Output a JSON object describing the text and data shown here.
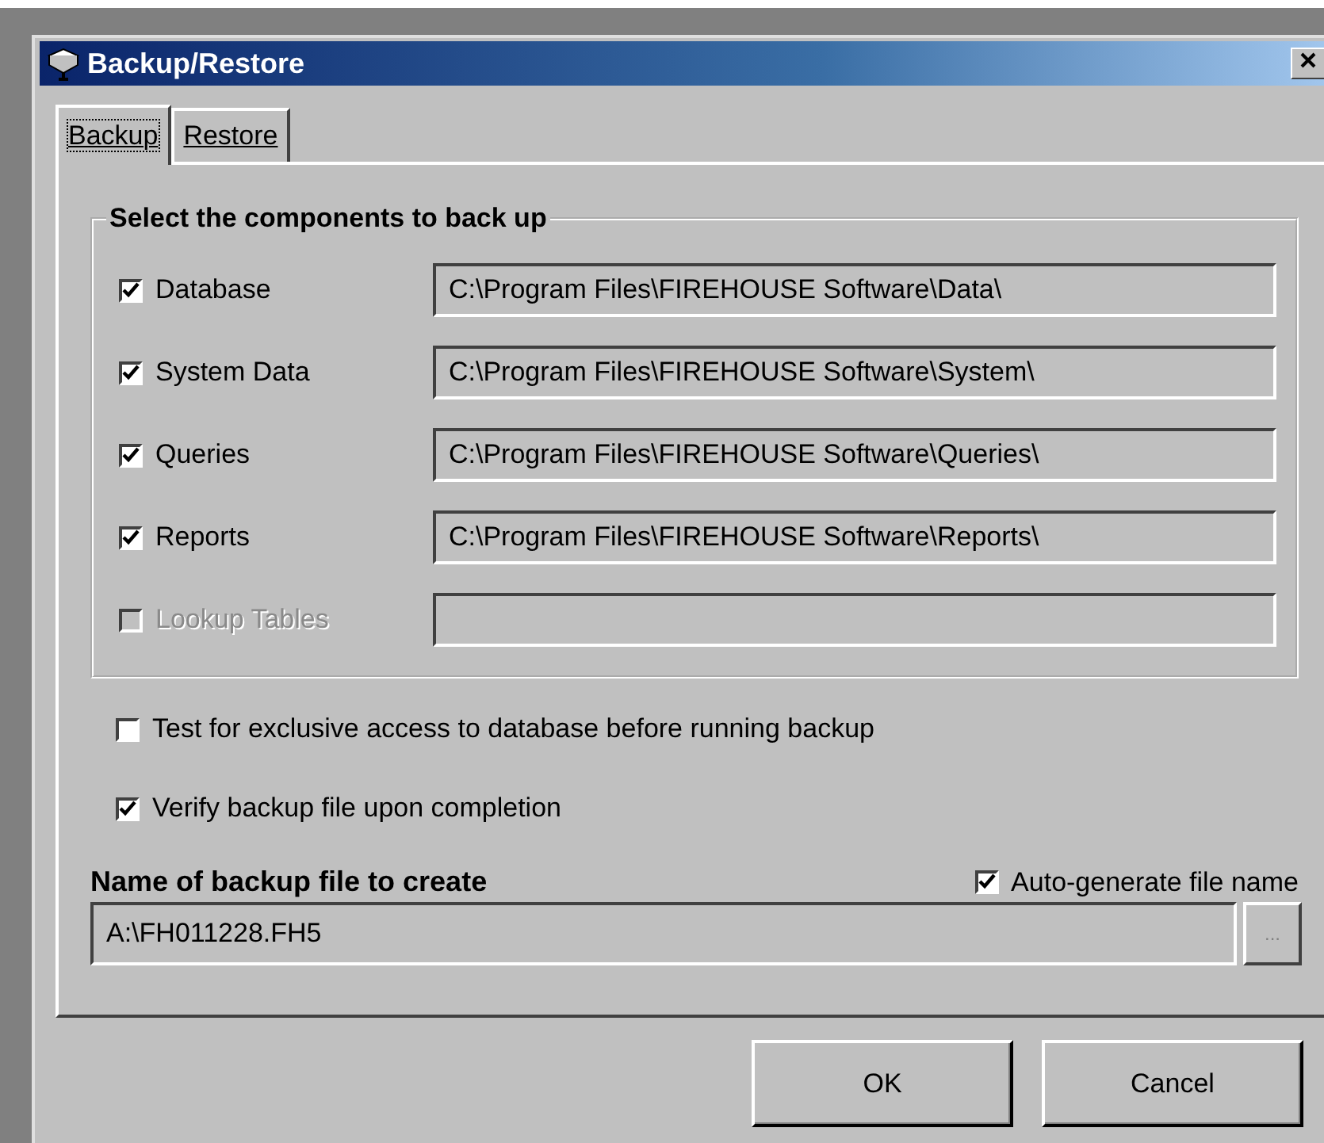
{
  "window": {
    "title": "Backup/Restore"
  },
  "tabs": [
    {
      "label": "Backup",
      "selected": true
    },
    {
      "label": "Restore",
      "selected": false
    }
  ],
  "group": {
    "title": "Select the components to back up",
    "components": [
      {
        "label": "Database",
        "checked": true,
        "disabled": false,
        "path": "C:\\Program Files\\FIREHOUSE Software\\Data\\"
      },
      {
        "label": "System Data",
        "checked": true,
        "disabled": false,
        "path": "C:\\Program Files\\FIREHOUSE Software\\System\\"
      },
      {
        "label": "Queries",
        "checked": true,
        "disabled": false,
        "path": "C:\\Program Files\\FIREHOUSE Software\\Queries\\"
      },
      {
        "label": "Reports",
        "checked": true,
        "disabled": false,
        "path": "C:\\Program Files\\FIREHOUSE Software\\Reports\\"
      },
      {
        "label": "Lookup Tables",
        "checked": false,
        "disabled": true
      }
    ]
  },
  "options": [
    {
      "label": "Test for exclusive access to database before running backup",
      "checked": false
    },
    {
      "label": "Verify backup file upon completion",
      "checked": true
    }
  ],
  "file": {
    "label": "Name of backup file to create",
    "auto_label": "Auto-generate file name",
    "auto_checked": true,
    "value": "A:\\FH011228.FH5",
    "browse": "..."
  },
  "buttons": [
    "OK",
    "Cancel"
  ]
}
